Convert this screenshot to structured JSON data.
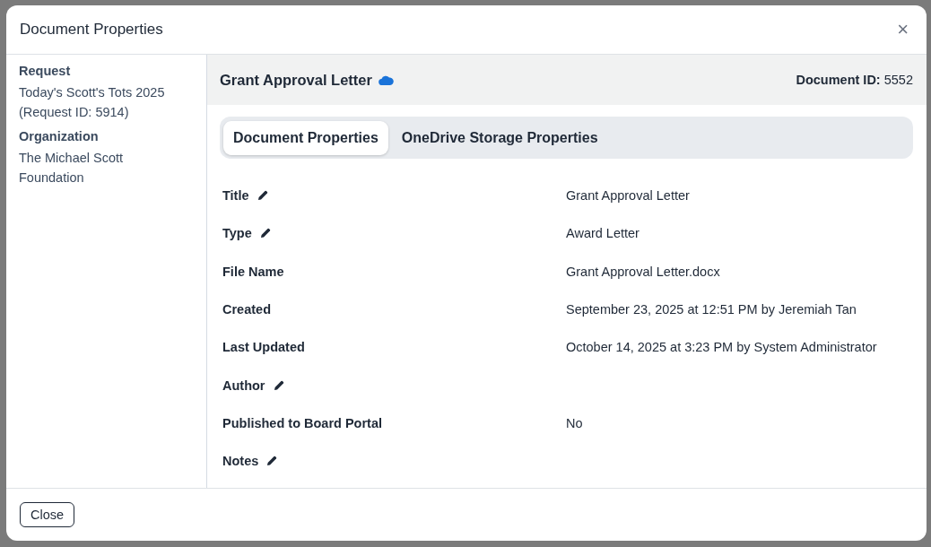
{
  "dialog": {
    "title": "Document Properties",
    "close_icon": "×"
  },
  "sidebar": {
    "sections": [
      {
        "heading": "Request",
        "lines": [
          "Today's Scott's Tots 2025",
          "(Request ID: 5914)"
        ]
      },
      {
        "heading": "Organization",
        "lines": [
          "The Michael Scott",
          "Foundation"
        ]
      }
    ]
  },
  "document": {
    "title": "Grant Approval Letter",
    "document_id": "**Document ID:** 5552"
  },
  "tabs": [
    {
      "label": "Document Properties",
      "selected": true
    },
    {
      "label": "OneDrive Storage Properties",
      "selected": false
    }
  ],
  "properties": [
    {
      "label": "Title",
      "editable": true,
      "value": "Grant Approval Letter"
    },
    {
      "label": "Type",
      "editable": true,
      "value": "Award Letter"
    },
    {
      "label": "File Name",
      "editable": false,
      "value": "Grant Approval Letter.docx"
    },
    {
      "label": "Created",
      "editable": false,
      "value": "September 23, 2025 at 12:51 PM by Jeremiah Tan"
    },
    {
      "label": "Last Updated",
      "editable": false,
      "value": "October 14, 2025 at 3:23 PM by System Administrator"
    },
    {
      "label": "Author",
      "editable": true
    },
    {
      "label": "Published to Board Portal",
      "editable": false,
      "value": "No"
    },
    {
      "label": "Notes",
      "editable": true
    }
  ],
  "footer": {
    "buttons": [
      "Close"
    ]
  }
}
